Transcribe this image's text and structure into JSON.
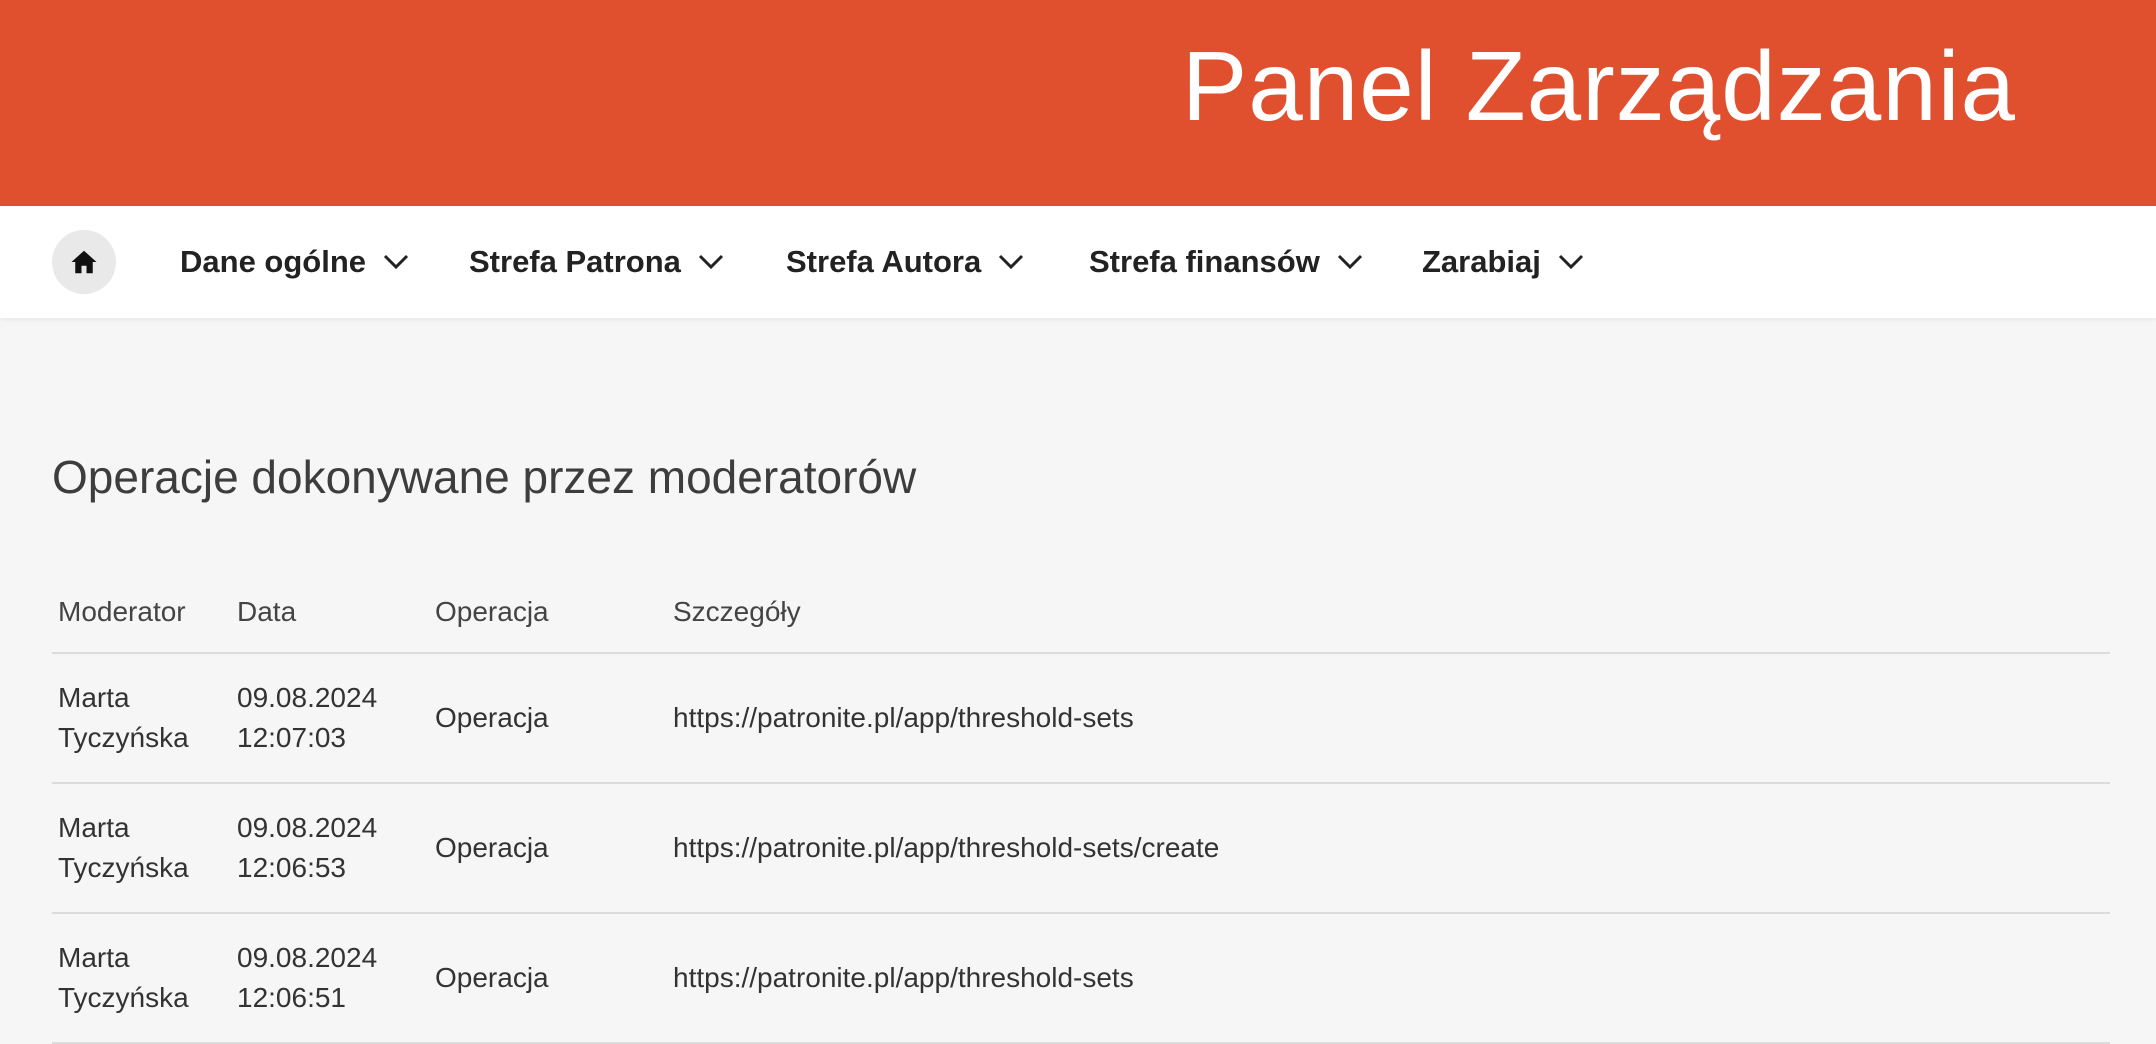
{
  "header": {
    "title": "Panel Zarządzania",
    "brand_color": "#e04f2e"
  },
  "nav": {
    "home_icon": "home-icon",
    "items": [
      {
        "label": "Dane ogólne"
      },
      {
        "label": "Strefa Patrona"
      },
      {
        "label": "Strefa Autora"
      },
      {
        "label": "Strefa finansów"
      },
      {
        "label": "Zarabiaj"
      }
    ]
  },
  "main": {
    "title": "Operacje dokonywane przez moderatorów",
    "table": {
      "columns": [
        "Moderator",
        "Data",
        "Operacja",
        "Szczegóły"
      ],
      "rows": [
        {
          "moderator_first": "Marta",
          "moderator_last": "Tyczyńska",
          "date": "09.08.2024",
          "time": "12:07:03",
          "operation": "Operacja",
          "details": "https://patronite.pl/app/threshold-sets"
        },
        {
          "moderator_first": "Marta",
          "moderator_last": "Tyczyńska",
          "date": "09.08.2024",
          "time": "12:06:53",
          "operation": "Operacja",
          "details": "https://patronite.pl/app/threshold-sets/create"
        },
        {
          "moderator_first": "Marta",
          "moderator_last": "Tyczyńska",
          "date": "09.08.2024",
          "time": "12:06:51",
          "operation": "Operacja",
          "details": "https://patronite.pl/app/threshold-sets"
        }
      ]
    }
  }
}
